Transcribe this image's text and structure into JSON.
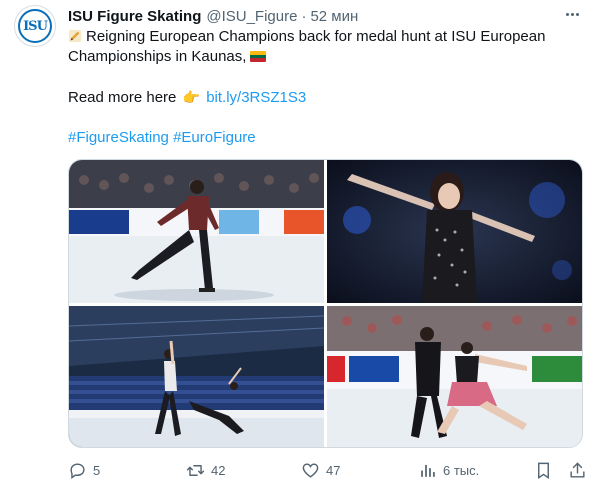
{
  "author": {
    "avatar_text": "ISU",
    "display_name": "ISU Figure Skating",
    "handle": "@ISU_Figure",
    "separator": "·",
    "time": "52 мин"
  },
  "tweet": {
    "line1": "Reigning European Champions back for medal hunt at ISU European",
    "line2": "Championships in Kaunas,",
    "read_more": "Read more here",
    "link": "bit.ly/3RSZ1S3",
    "hashtag1": "#FigureSkating",
    "hashtag2": "#EuroFigure"
  },
  "media": {
    "photos": [
      {
        "subject": "male-skater"
      },
      {
        "subject": "female-skater"
      },
      {
        "subject": "pairs-skaters"
      },
      {
        "subject": "ice-dance-couple"
      }
    ]
  },
  "actions": {
    "replies": "5",
    "retweets": "42",
    "likes": "47",
    "views": "6 тыс."
  },
  "colors": {
    "link": "#1d9bf0",
    "muted": "#536471",
    "text": "#0f1419"
  },
  "icons": [
    "more-icon",
    "pencil-icon",
    "lithuania-flag-icon",
    "pointing-hand-icon",
    "reply-icon",
    "retweet-icon",
    "like-icon",
    "views-icon",
    "bookmark-icon",
    "share-icon"
  ]
}
